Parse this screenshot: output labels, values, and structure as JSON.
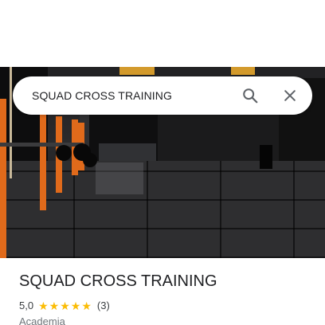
{
  "search": {
    "query": "SQUAD CROSS TRAINING",
    "search_icon": "search-icon",
    "close_icon": "close-icon"
  },
  "photo": {
    "icon": "place-photo"
  },
  "place": {
    "name": "SQUAD CROSS TRAINING",
    "rating": "5,0",
    "stars_filled": 5,
    "stars_total": 5,
    "review_count": "(3)",
    "category": "Academia"
  },
  "colors": {
    "star": "#fbbc04",
    "title": "#202124",
    "accent_rack": "#e06a1b"
  }
}
